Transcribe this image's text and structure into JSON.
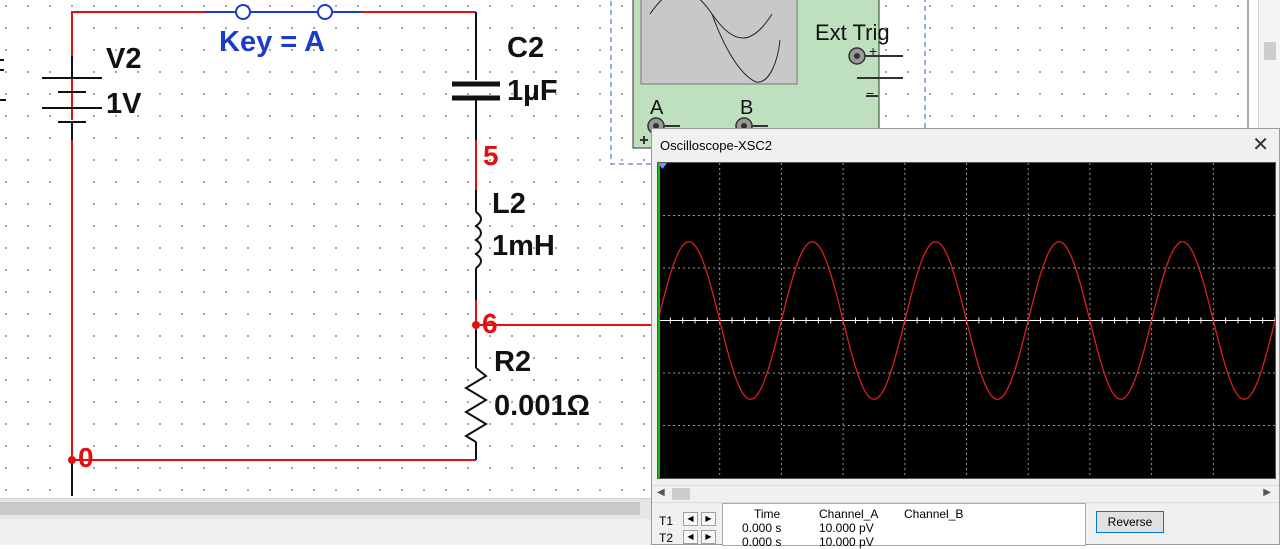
{
  "schematic": {
    "key_label": "Key = A",
    "components": {
      "v2_name": "V2",
      "v2_value": "1V",
      "c2_name": "C2",
      "c2_value": "1µF",
      "l2_name": "L2",
      "l2_value": "1mH",
      "r2_name": "R2",
      "r2_value": "0.001Ω"
    },
    "nodes": {
      "n5": "5",
      "n6": "6",
      "n0": "0"
    },
    "scope_icon": {
      "ext_trig": "Ext Trig",
      "ch_a": "A",
      "ch_b": "B",
      "plus": "+",
      "minus": "−"
    }
  },
  "oscilloscope": {
    "title": "Oscilloscope-XSC2",
    "close_icon": "close-icon",
    "colors": {
      "trace": "#d82020",
      "grid": "#9a9a9a",
      "screen": "#000000",
      "baseline": "#ffffff"
    },
    "trace": {
      "cycles_visible": 5,
      "amplitude_divisions": 1.5
    },
    "readout": {
      "headers": {
        "time": "Time",
        "channel_a": "Channel_A",
        "channel_b": "Channel_B"
      },
      "rows": [
        {
          "label": "T1",
          "time": "0.000 s",
          "channel_a": "10.000 pV",
          "channel_b": ""
        },
        {
          "label": "T2",
          "time": "0.000 s",
          "channel_a": "10.000 pV",
          "channel_b": ""
        }
      ]
    },
    "reverse_label": "Reverse"
  }
}
